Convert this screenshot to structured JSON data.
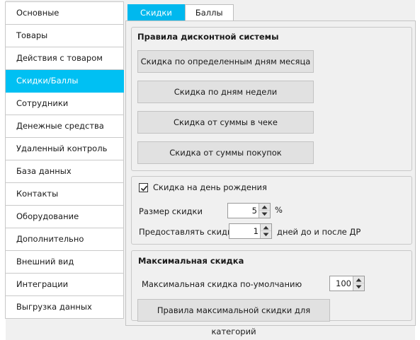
{
  "sidebar": {
    "items": [
      {
        "label": "Основные"
      },
      {
        "label": "Товары"
      },
      {
        "label": "Действия с товаром"
      },
      {
        "label": "Скидки/Баллы",
        "active": true
      },
      {
        "label": "Сотрудники"
      },
      {
        "label": "Денежные средства"
      },
      {
        "label": "Удаленный контроль"
      },
      {
        "label": "База данных"
      },
      {
        "label": "Контакты"
      },
      {
        "label": "Оборудование"
      },
      {
        "label": "Дополнительно"
      },
      {
        "label": "Внешний вид"
      },
      {
        "label": "Интеграции"
      },
      {
        "label": "Выгрузка данных"
      }
    ]
  },
  "tabs": {
    "discounts": "Скидки",
    "points": "Баллы"
  },
  "discount_rules": {
    "title": "Правила дисконтной системы",
    "btn_days_of_month": "Скидка по определенным дням месяца",
    "btn_week_days": "Скидка по дням недели",
    "btn_receipt_sum": "Скидка от суммы в чеке",
    "btn_purchases_sum": "Скидка от суммы покупок"
  },
  "birthday": {
    "checkbox_label": "Скидка на день рождения",
    "checked": true,
    "size_label": "Размер скидки",
    "size_value": "5",
    "size_unit": "%",
    "provide_label": "Предоставлять скидку",
    "provide_value": "1",
    "provide_suffix": "дней до и после ДР"
  },
  "max_discount": {
    "title": "Максимальная скидка",
    "default_label": "Максимальная скидка по-умолчанию",
    "default_value": "100",
    "category_rules_button": "Правила максимальной скидки для категорий"
  },
  "colors": {
    "accent": "#00c0f3",
    "active_text": "#ffffff"
  }
}
